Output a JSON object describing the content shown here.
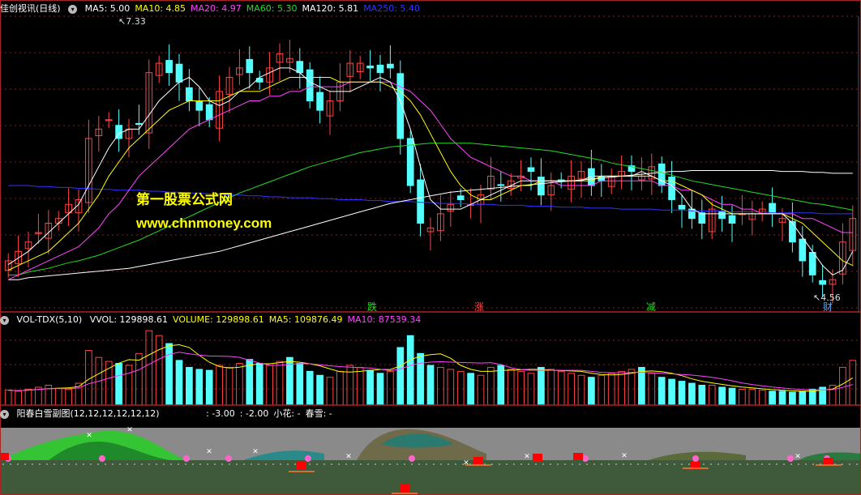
{
  "colors": {
    "up": "#ff4444",
    "down": "#54ffff",
    "ma5": "#ffffff",
    "ma10": "#ffff00",
    "ma20": "#ff44ff",
    "ma60": "#22dd22",
    "ma120": "#ffffff",
    "ma250": "#3333ff",
    "grid": "#8b1a1a",
    "panel_line": "#aa2222"
  },
  "main": {
    "title": "佳创视讯(日线)",
    "ma_labels": [
      {
        "text": "MA5: 5.00",
        "color": "#ffffff"
      },
      {
        "text": "MA10: 4.85",
        "color": "#ffff00"
      },
      {
        "text": "MA20: 4.97",
        "color": "#ff44ff"
      },
      {
        "text": "MA60: 5.30",
        "color": "#22dd22"
      },
      {
        "text": "MA120: 5.81",
        "color": "#ffffff"
      },
      {
        "text": "MA250: 5.40",
        "color": "#3333ff"
      }
    ],
    "high_label": "7.33",
    "low_label": "4.56",
    "markers": [
      {
        "text": "跌",
        "color": "#22dd22"
      },
      {
        "text": "涨",
        "color": "#ff4444"
      },
      {
        "text": "减",
        "color": "#22dd22"
      },
      {
        "text": "财",
        "color": "#54aaff"
      }
    ],
    "watermark": {
      "line1": "第一股票公式网",
      "line2": "www.chnmoney.com"
    }
  },
  "volume": {
    "title": "VOL-TDX(5,10)",
    "labels": [
      {
        "text": "VVOL: 129898.61",
        "color": "#ffffff"
      },
      {
        "text": "VOLUME: 129898.61",
        "color": "#ffff00"
      },
      {
        "text": "MA5: 109876.49",
        "color": "#ffff00"
      },
      {
        "text": "MA10: 87539.34",
        "color": "#ff44ff"
      }
    ]
  },
  "indicator": {
    "title": "阳春白雪副图(12,12,12,12,12,12)",
    "labels": [
      {
        "text": ": -3.00",
        "color": "#ffffff"
      },
      {
        "text": ": -2.00",
        "color": "#ffffff"
      },
      {
        "text": "小花: -",
        "color": "#ffffff"
      },
      {
        "text": "春雪: -",
        "color": "#ffffff"
      }
    ]
  },
  "chart_data": {
    "type": "candlestick",
    "x_count": 85,
    "closes": [
      4.9,
      5.0,
      5.1,
      5.2,
      5.3,
      5.35,
      5.5,
      5.55,
      6.2,
      6.3,
      6.4,
      6.2,
      6.3,
      6.35,
      6.9,
      7.0,
      6.9,
      6.8,
      6.6,
      6.5,
      6.4,
      6.7,
      6.85,
      6.95,
      6.9,
      6.8,
      6.95,
      7.1,
      7.05,
      6.9,
      6.6,
      6.5,
      6.6,
      6.8,
      7.0,
      7.0,
      6.95,
      6.9,
      6.95,
      6.2,
      5.7,
      5.3,
      5.25,
      5.4,
      5.5,
      5.55,
      5.5,
      5.6,
      5.8,
      5.7,
      5.75,
      5.8,
      5.85,
      5.6,
      5.7,
      5.75,
      5.8,
      5.85,
      5.7,
      5.75,
      5.8,
      5.85,
      5.85,
      5.8,
      5.9,
      5.7,
      5.55,
      5.45,
      5.35,
      5.3,
      5.45,
      5.35,
      5.3,
      5.4,
      5.4,
      5.45,
      5.4,
      5.35,
      5.1,
      4.9,
      4.75,
      4.65,
      4.7,
      5.1,
      5.35
    ],
    "ma5": [
      4.86,
      4.93,
      5.0,
      5.1,
      5.2,
      5.3,
      5.4,
      5.5,
      5.7,
      5.9,
      6.1,
      6.25,
      6.3,
      6.3,
      6.45,
      6.6,
      6.7,
      6.8,
      6.85,
      6.75,
      6.6,
      6.55,
      6.6,
      6.7,
      6.75,
      6.85,
      6.9,
      6.95,
      6.95,
      6.9,
      6.8,
      6.75,
      6.7,
      6.7,
      6.7,
      6.75,
      6.8,
      6.85,
      6.8,
      6.6,
      6.3,
      5.9,
      5.55,
      5.45,
      5.45,
      5.45,
      5.5,
      5.55,
      5.6,
      5.65,
      5.7,
      5.75,
      5.75,
      5.75,
      5.75,
      5.75,
      5.75,
      5.75,
      5.8,
      5.8,
      5.8,
      5.8,
      5.8,
      5.85,
      5.8,
      5.75,
      5.7,
      5.6,
      5.45,
      5.4,
      5.4,
      5.4,
      5.4,
      5.4,
      5.4,
      5.4,
      5.4,
      5.4,
      5.3,
      5.15,
      5.0,
      4.85,
      4.75,
      4.8,
      5.0
    ],
    "ma10": [
      4.8,
      4.85,
      4.9,
      4.95,
      5.0,
      5.1,
      5.2,
      5.3,
      5.45,
      5.6,
      5.8,
      5.95,
      6.1,
      6.2,
      6.3,
      6.4,
      6.5,
      6.55,
      6.6,
      6.6,
      6.6,
      6.6,
      6.65,
      6.7,
      6.7,
      6.7,
      6.75,
      6.8,
      6.85,
      6.85,
      6.85,
      6.85,
      6.85,
      6.8,
      6.8,
      6.8,
      6.8,
      6.8,
      6.75,
      6.7,
      6.6,
      6.45,
      6.25,
      6.05,
      5.85,
      5.7,
      5.6,
      5.55,
      5.55,
      5.6,
      5.65,
      5.7,
      5.7,
      5.75,
      5.75,
      5.75,
      5.75,
      5.75,
      5.75,
      5.8,
      5.8,
      5.8,
      5.8,
      5.8,
      5.8,
      5.75,
      5.75,
      5.7,
      5.65,
      5.6,
      5.5,
      5.45,
      5.4,
      5.4,
      5.4,
      5.4,
      5.4,
      5.4,
      5.35,
      5.3,
      5.2,
      5.1,
      5.0,
      4.9,
      4.85
    ],
    "ma20": [
      4.7,
      4.75,
      4.8,
      4.85,
      4.9,
      4.95,
      5.0,
      5.05,
      5.15,
      5.25,
      5.4,
      5.5,
      5.65,
      5.8,
      5.9,
      6.0,
      6.1,
      6.2,
      6.3,
      6.35,
      6.4,
      6.45,
      6.5,
      6.55,
      6.6,
      6.6,
      6.65,
      6.65,
      6.7,
      6.7,
      6.75,
      6.75,
      6.75,
      6.75,
      6.8,
      6.8,
      6.8,
      6.8,
      6.8,
      6.75,
      6.7,
      6.6,
      6.5,
      6.35,
      6.2,
      6.1,
      6.0,
      5.95,
      5.9,
      5.85,
      5.8,
      5.8,
      5.75,
      5.75,
      5.75,
      5.7,
      5.7,
      5.7,
      5.7,
      5.75,
      5.75,
      5.75,
      5.75,
      5.75,
      5.75,
      5.7,
      5.7,
      5.65,
      5.65,
      5.6,
      5.55,
      5.5,
      5.5,
      5.45,
      5.45,
      5.4,
      5.4,
      5.4,
      5.4,
      5.35,
      5.35,
      5.3,
      5.25,
      5.2,
      5.2
    ],
    "ma60": [
      4.75,
      4.75,
      4.78,
      4.8,
      4.82,
      4.85,
      4.88,
      4.9,
      4.93,
      4.96,
      5.0,
      5.04,
      5.08,
      5.12,
      5.17,
      5.22,
      5.27,
      5.32,
      5.37,
      5.42,
      5.47,
      5.52,
      5.57,
      5.62,
      5.66,
      5.7,
      5.74,
      5.78,
      5.82,
      5.86,
      5.9,
      5.93,
      5.96,
      5.99,
      6.02,
      6.05,
      6.07,
      6.09,
      6.11,
      6.12,
      6.13,
      6.14,
      6.15,
      6.15,
      6.15,
      6.15,
      6.15,
      6.14,
      6.13,
      6.12,
      6.11,
      6.1,
      6.09,
      6.08,
      6.07,
      6.05,
      6.03,
      6.01,
      5.99,
      5.97,
      5.94,
      5.92,
      5.9,
      5.88,
      5.86,
      5.84,
      5.81,
      5.78,
      5.75,
      5.73,
      5.71,
      5.69,
      5.67,
      5.65,
      5.63,
      5.61,
      5.59,
      5.57,
      5.55,
      5.53,
      5.51,
      5.5,
      5.48,
      5.46,
      5.44
    ],
    "ma120": [
      4.7,
      4.7,
      4.72,
      4.73,
      4.74,
      4.75,
      4.76,
      4.77,
      4.78,
      4.79,
      4.8,
      4.81,
      4.82,
      4.84,
      4.86,
      4.88,
      4.9,
      4.92,
      4.94,
      4.96,
      4.98,
      5.0,
      5.03,
      5.06,
      5.09,
      5.12,
      5.15,
      5.18,
      5.21,
      5.24,
      5.27,
      5.3,
      5.33,
      5.36,
      5.39,
      5.42,
      5.45,
      5.48,
      5.51,
      5.53,
      5.55,
      5.57,
      5.59,
      5.61,
      5.63,
      5.64,
      5.65,
      5.66,
      5.67,
      5.68,
      5.69,
      5.7,
      5.71,
      5.72,
      5.73,
      5.74,
      5.75,
      5.76,
      5.77,
      5.78,
      5.79,
      5.8,
      5.81,
      5.82,
      5.83,
      5.84,
      5.85,
      5.85,
      5.86,
      5.86,
      5.86,
      5.86,
      5.86,
      5.86,
      5.86,
      5.86,
      5.86,
      5.85,
      5.85,
      5.85,
      5.84,
      5.84,
      5.83,
      5.83,
      5.83
    ],
    "ma250": [
      5.7,
      5.7,
      5.7,
      5.69,
      5.69,
      5.68,
      5.68,
      5.67,
      5.67,
      5.66,
      5.66,
      5.65,
      5.65,
      5.65,
      5.64,
      5.64,
      5.63,
      5.63,
      5.62,
      5.62,
      5.61,
      5.61,
      5.6,
      5.6,
      5.59,
      5.59,
      5.58,
      5.58,
      5.57,
      5.57,
      5.57,
      5.56,
      5.56,
      5.55,
      5.55,
      5.55,
      5.54,
      5.54,
      5.53,
      5.53,
      5.53,
      5.52,
      5.52,
      5.51,
      5.51,
      5.51,
      5.5,
      5.5,
      5.5,
      5.49,
      5.49,
      5.49,
      5.48,
      5.48,
      5.48,
      5.47,
      5.47,
      5.47,
      5.46,
      5.46,
      5.46,
      5.45,
      5.45,
      5.45,
      5.45,
      5.44,
      5.44,
      5.44,
      5.43,
      5.43,
      5.43,
      5.43,
      5.42,
      5.42,
      5.42,
      5.42,
      5.41,
      5.41,
      5.41,
      5.41,
      5.41,
      5.4,
      5.4,
      5.4,
      5.4
    ],
    "volume": [
      15,
      14,
      16,
      18,
      20,
      17,
      16,
      22,
      55,
      48,
      44,
      42,
      40,
      52,
      75,
      70,
      62,
      45,
      38,
      36,
      35,
      40,
      38,
      42,
      46,
      42,
      40,
      44,
      48,
      42,
      34,
      30,
      28,
      34,
      40,
      38,
      35,
      32,
      34,
      58,
      70,
      52,
      40,
      38,
      36,
      34,
      32,
      30,
      38,
      40,
      36,
      34,
      32,
      38,
      36,
      34,
      32,
      30,
      28,
      30,
      32,
      34,
      36,
      38,
      32,
      28,
      26,
      24,
      22,
      20,
      20,
      18,
      17,
      16,
      16,
      15,
      14,
      14,
      13,
      14,
      16,
      18,
      20,
      38,
      45
    ],
    "ylim": [
      4.4,
      7.5
    ]
  }
}
